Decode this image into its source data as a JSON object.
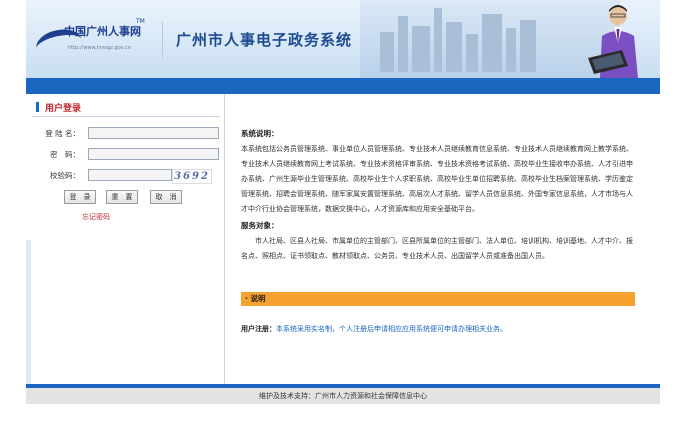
{
  "header": {
    "logo_text": "中国广州人事网",
    "logo_tm": "TM",
    "logo_url": "http://www.hrssgz.gov.cn",
    "title": "广州市人事电子政务系统"
  },
  "login": {
    "panel_title": "用户登录",
    "username_label": "登 陆 名：",
    "username_value": "",
    "password_label": "密　码：",
    "password_value": "",
    "captcha_label": "校验码：",
    "captcha_value": "",
    "captcha_image_text": "3692",
    "login_button": "登　录",
    "reset_button": "重　置",
    "cancel_button": "取　消",
    "forgot_password": "忘记密码"
  },
  "info": {
    "system_desc_heading": "系统说明：",
    "system_desc": "本系统包括公务员管理系统、事业单位人员管理系统、专业技术人员继续教育信息系统、专业技术人员继续教育网上教学系统、专业技术人员继续教育网上考试系统、专业技术资格评审系统、专业技术资格考试系统、高校毕业生接收申办系统、人才引进申办系统、广州生源毕业生管理系统、高校毕业生个人求职系统、高校毕业生单位招聘系统、高校毕业生档案管理系统、学历鉴定管理系统、招聘会管理系统、随军家属安置管理系统、高层次人才系统、留学人员信息系统、外国专家信息系统，人才市场与人才中介行业协会管理系统，数据交换中心，人才资源库和应用安全基础平台。",
    "service_heading": "服务对象：",
    "service_desc": "　　市人社局、区县人社局、市属单位的主管部门、区县所属单位的主管部门、法人单位、培训机构、培训基地、人才中介、报名点、照相点、证书领取点、教材领取点、公务员、专业技术人员、出国留学人员或准备出国人员。",
    "notice_bar": "· 说明",
    "register_label": "用户注册：",
    "register_text": "本系统采用实名制，个人注册后申请相应应用系统便可申请办理相关业务。"
  },
  "footer": {
    "text": "维护及技术支持：广州市人力资源和社会保障信息中心"
  },
  "colors": {
    "brand_blue": "#1a66c0",
    "title_blue": "#1d4b91",
    "notice_orange": "#f6a231",
    "accent_red": "#c1272d"
  }
}
